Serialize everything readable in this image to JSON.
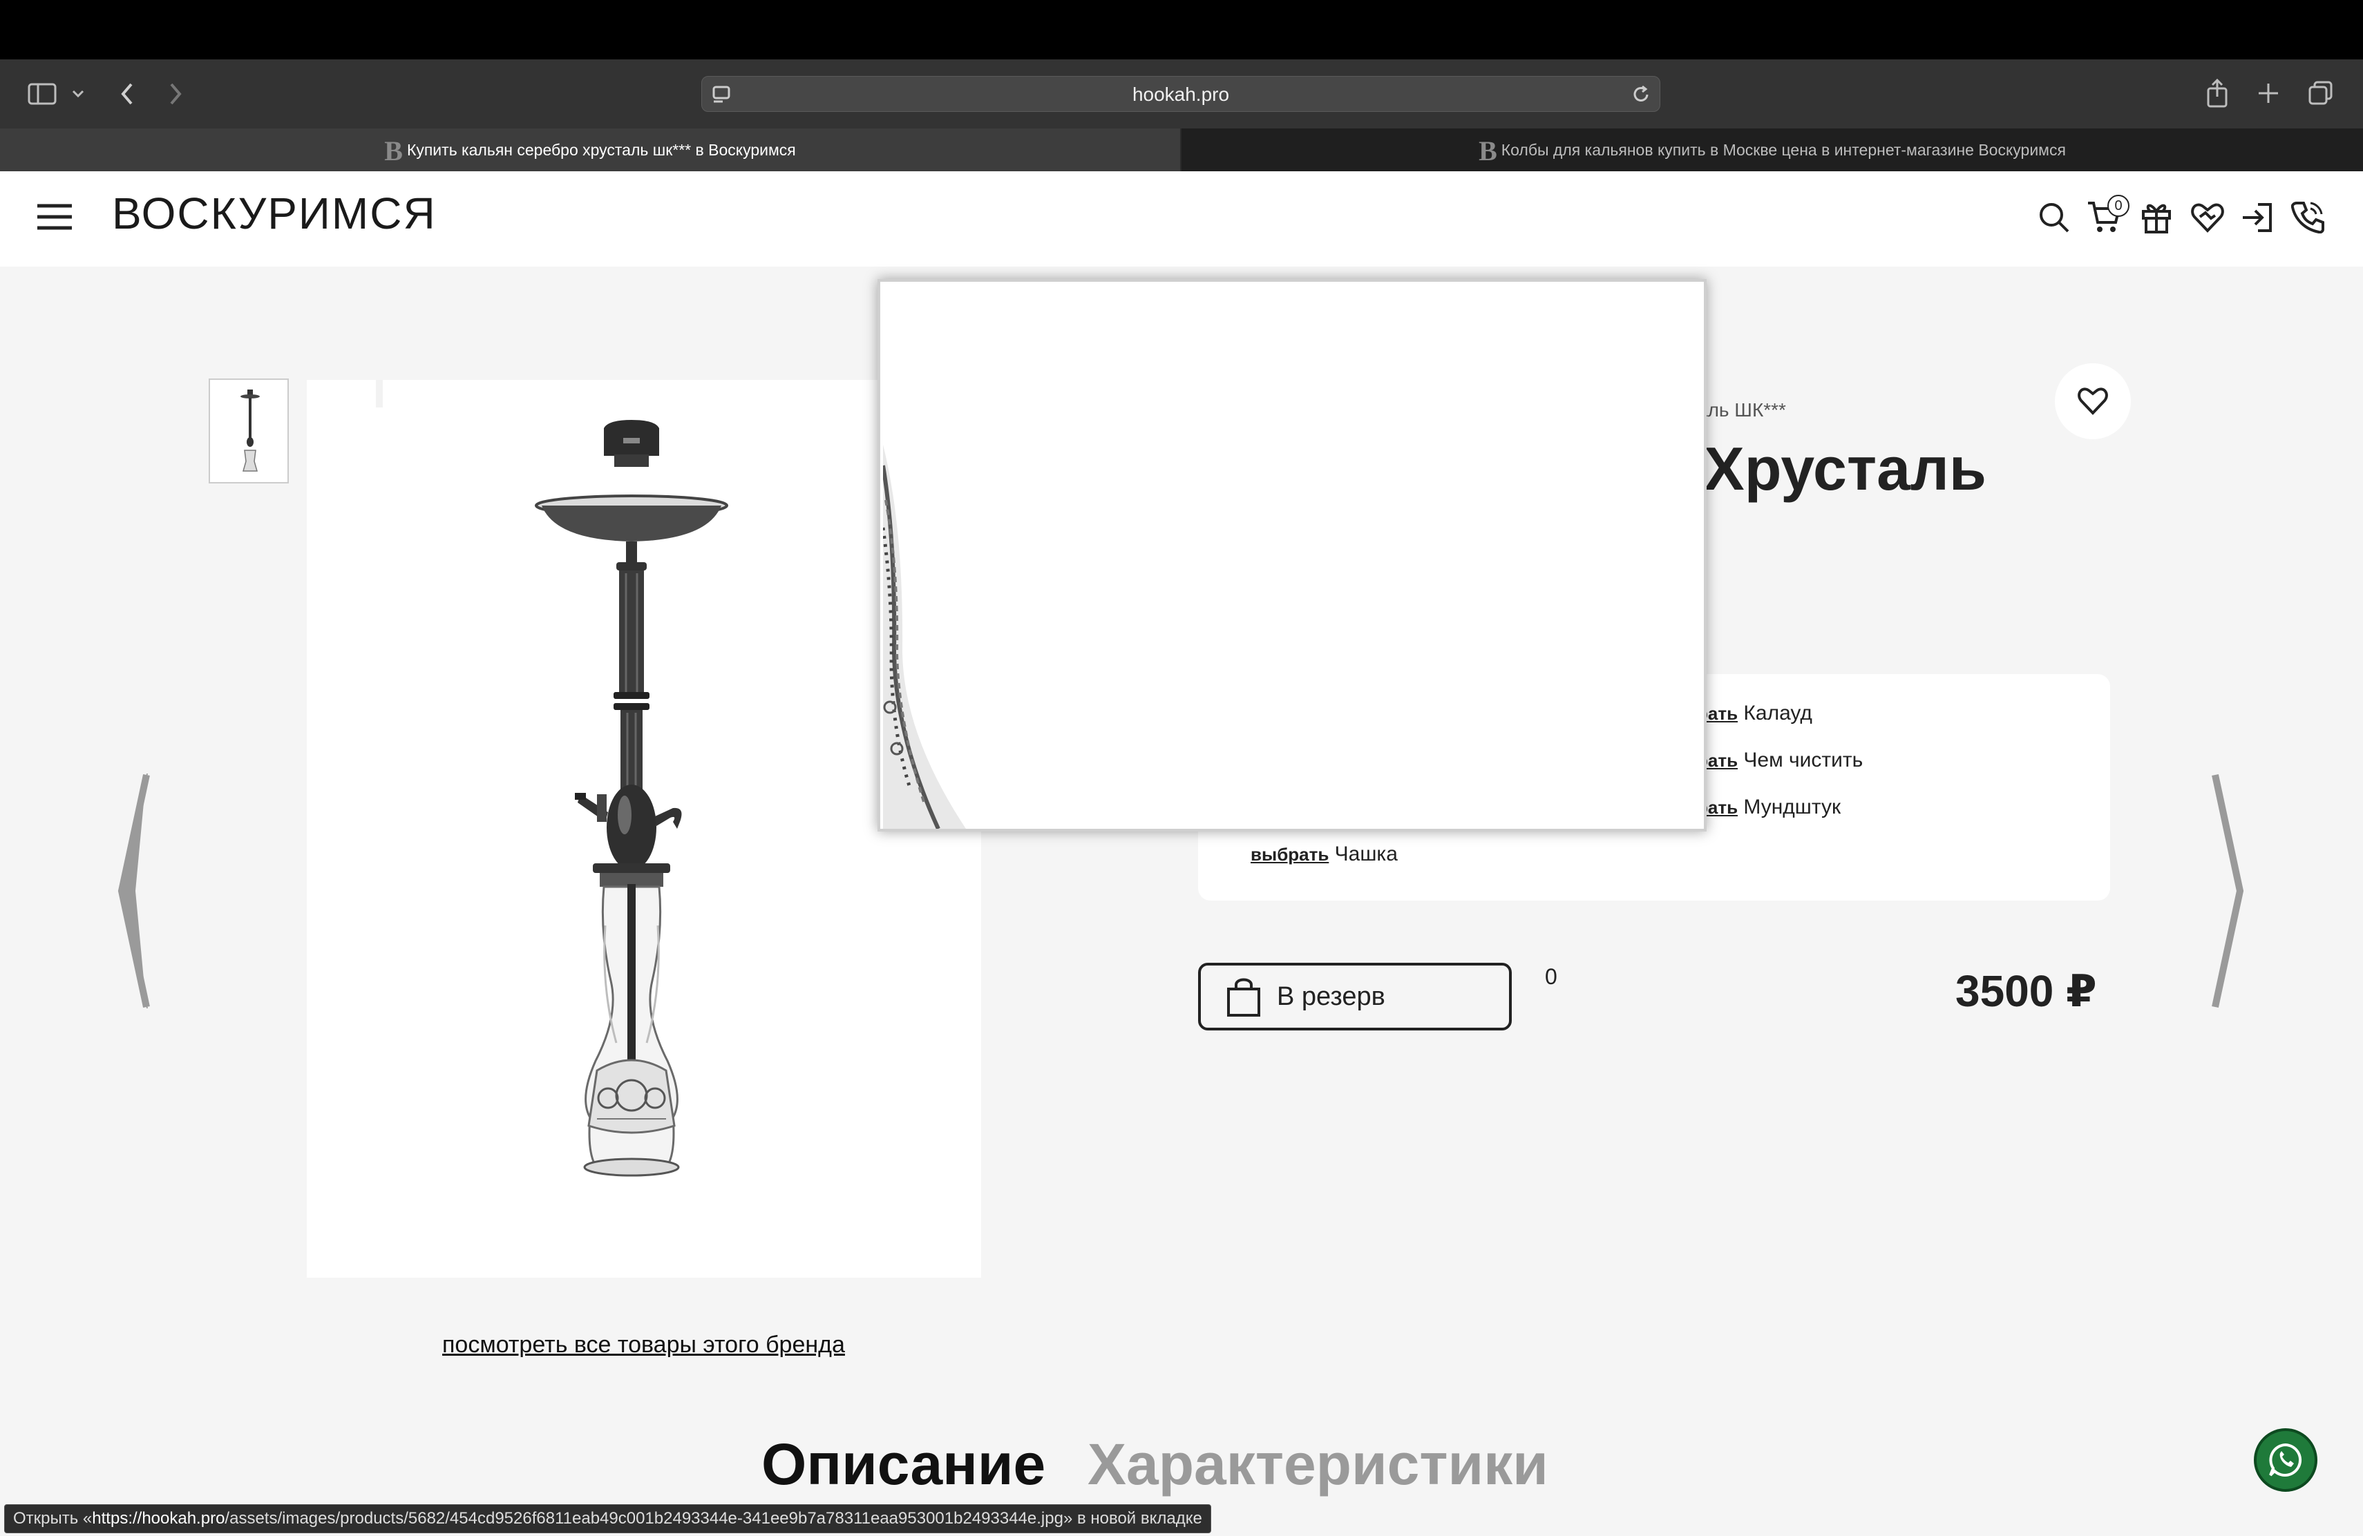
{
  "browser": {
    "url": "hookah.pro",
    "tabs": [
      {
        "label": "Купить кальян серебро хрусталь шк*** в Воскуримся",
        "active": true
      },
      {
        "label": "Колбы для кальянов купить в Москве цена в интернет-магазине Воскуримся",
        "active": false
      }
    ],
    "tab_logo": "B",
    "status_prefix": "Открыть «",
    "status_host": "https://hookah.pro",
    "status_path": "/assets/images/products/5682/454cd9526f6811eab49c001b2493344e-341ee9b7a78311eaa953001b2493344e.jpg",
    "status_suffix": "» в новой вкладке"
  },
  "header": {
    "logo": "ВОСКУРИМСЯ",
    "cart_count": "0",
    "icons": [
      "menu-icon",
      "search-icon",
      "cart-icon",
      "gift-icon",
      "heart-handshake-icon",
      "login-icon",
      "phone-icon"
    ]
  },
  "product": {
    "brand_fragment": "аль ШК***",
    "title_fragment": "Хрусталь",
    "accessories": [
      {
        "link": "рать",
        "name": "Калауд"
      },
      {
        "link": "рать",
        "name": "Чем чистить"
      },
      {
        "link": "рать",
        "name": "Мундштук"
      },
      {
        "link": "выбрать",
        "name": "Чашка"
      }
    ],
    "reserve_label": "В резерв",
    "quantity": "0",
    "price": "3500 ₽",
    "brand_link": "посмотреть все товары этого бренда"
  },
  "section_tabs": {
    "description": "Описание",
    "characteristics": "Характеристики"
  },
  "colors": {
    "accent": "#222222",
    "whatsapp": "#1f7a3a",
    "inactive_tab": "#9a9a9a"
  }
}
